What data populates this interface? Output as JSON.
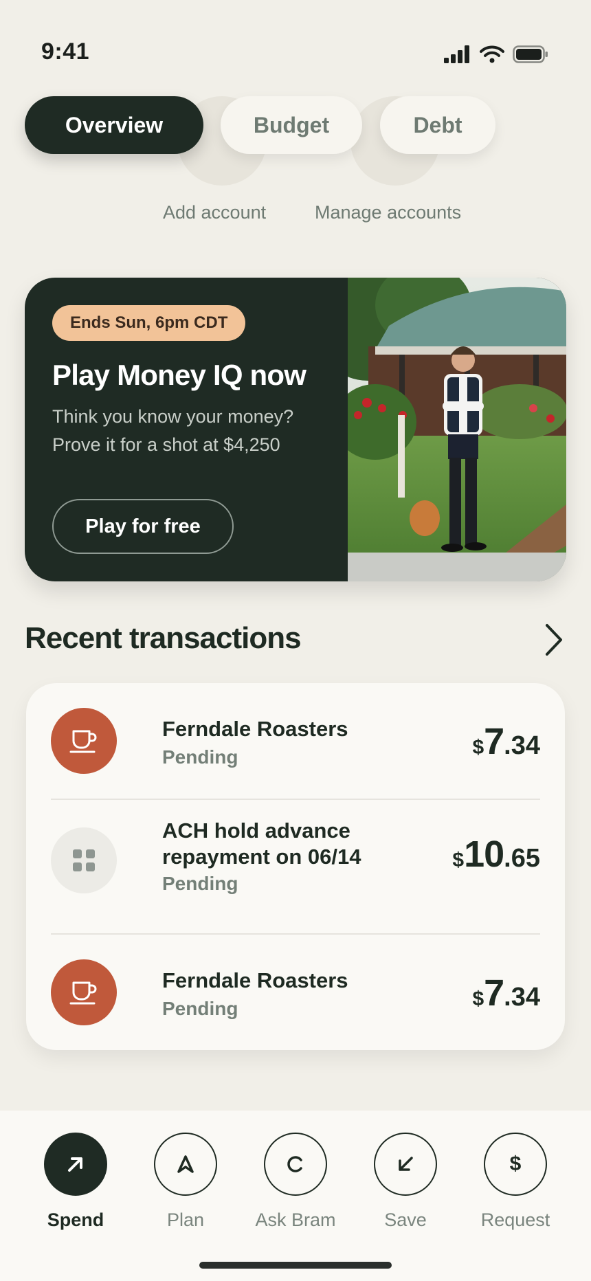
{
  "status_bar": {
    "time": "9:41"
  },
  "tabs": [
    {
      "label": "Overview",
      "active": true
    },
    {
      "label": "Budget",
      "active": false
    },
    {
      "label": "Debt",
      "active": false
    }
  ],
  "account_links": {
    "add": "Add account",
    "manage": "Manage accounts"
  },
  "promo": {
    "badge": "Ends Sun, 6pm CDT",
    "title": "Play Money IQ now",
    "text": "Think you know your money? Prove it for a shot at $4,250",
    "button": "Play for free"
  },
  "recent": {
    "title": "Recent transactions",
    "transactions": [
      {
        "name": "Ferndale Roasters",
        "status": "Pending",
        "currency": "$",
        "whole": "7",
        "cents": ".34",
        "icon": "coffee-cup-icon"
      },
      {
        "name": "ACH hold advance repayment on 06/14",
        "status": "Pending",
        "currency": "$",
        "whole": "10",
        "cents": ".65",
        "icon": "grid-icon"
      },
      {
        "name": "Ferndale Roasters",
        "status": "Pending",
        "currency": "$",
        "whole": "7",
        "cents": ".34",
        "icon": "coffee-cup-icon"
      }
    ]
  },
  "nav": [
    {
      "label": "Spend",
      "icon": "arrow-up-right-icon",
      "active": true
    },
    {
      "label": "Plan",
      "icon": "plan-icon",
      "active": false
    },
    {
      "label": "Ask Bram",
      "icon": "c-letter-icon",
      "active": false
    },
    {
      "label": "Save",
      "icon": "arrow-down-left-icon",
      "active": false
    },
    {
      "label": "Request",
      "icon": "dollar-icon",
      "active": false,
      "glyph": "$"
    }
  ],
  "colors": {
    "background": "#F1EFE8",
    "dark_green": "#1F2B24",
    "badge_peach": "#F2C398",
    "coffee_orange": "#C0593B"
  }
}
